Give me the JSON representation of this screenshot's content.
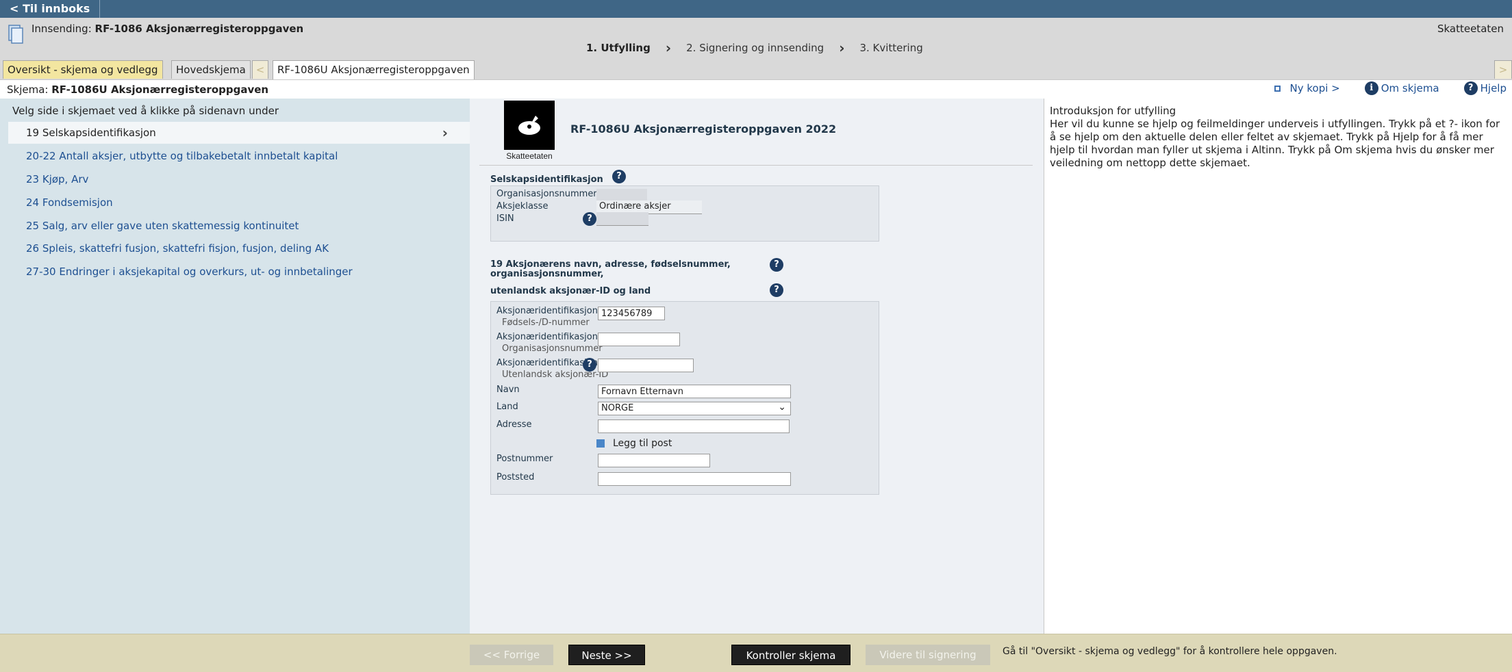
{
  "topbar": {
    "back_label": "< Til innboks"
  },
  "header": {
    "submission_prefix": "Innsending: ",
    "submission_name": "RF-1086 Aksjonærregisteroppgaven",
    "organization": "Skatteetaten",
    "steps": [
      "1. Utfylling",
      "2. Signering og innsending",
      "3. Kvittering"
    ]
  },
  "tabs": {
    "overview": "Oversikt - skjema og vedlegg",
    "main": "Hovedskjema",
    "prev_arrow": "<",
    "current": "RF-1086U Aksjonærregisteroppgaven",
    "next_arrow": ">"
  },
  "schemabar": {
    "prefix": "Skjema: ",
    "name": "RF-1086U Aksjonærregisteroppgaven",
    "new_copy": "Ny kopi >",
    "about": "Om skjema",
    "help": "Hjelp"
  },
  "sidebar": {
    "title": "Velg side i skjemaet ved å klikke på sidenavn under",
    "items": [
      {
        "label": "19 Selskapsidentifikasjon"
      },
      {
        "label": "20-22 Antall aksjer, utbytte og tilbakebetalt innbetalt kapital"
      },
      {
        "label": "23 Kjøp, Arv"
      },
      {
        "label": "24 Fondsemisjon"
      },
      {
        "label": "25 Salg, arv eller gave uten skattemessig kontinuitet"
      },
      {
        "label": "26 Spleis, skattefri fusjon, skattefri fisjon, fusjon, deling AK"
      },
      {
        "label": "27-30 Endringer i aksjekapital og overkurs, ut- og innbetalinger"
      }
    ]
  },
  "form": {
    "logo_text": "Skatteetaten",
    "title": "RF-1086U Aksjonærregisteroppgaven 2022",
    "section1": {
      "title": "Selskapsidentifikasjon",
      "org_label": "Organisasjonsnummer",
      "class_label": "Aksjeklasse",
      "class_value": "Ordinære aksjer",
      "isin_label": "ISIN"
    },
    "section2": {
      "title_line1": "19 Aksjonærens navn, adresse, fødselsnummer,",
      "title_line2": "organisasjonsnummer,",
      "title_line3": "utenlandsk aksjonær-ID og land",
      "id_label": "Aksjonæridentifikasjon",
      "id_sub1": "Fødsels-/D-nummer",
      "id_value1": "123456789",
      "id_sub2": "Organisasjonsnummer",
      "id_sub3": "Utenlandsk aksjonær-ID",
      "name_label": "Navn",
      "name_value": "Fornavn Etternavn",
      "country_label": "Land",
      "country_value": "NORGE",
      "address_label": "Adresse",
      "add_post": "Legg til post",
      "postnr_label": "Postnummer",
      "poststed_label": "Poststed"
    }
  },
  "help_panel": {
    "title": "Introduksjon for utfylling",
    "body": "Her vil du kunne se hjelp og feilmeldinger underveis i utfyllingen. Trykk på et ?- ikon for å se hjelp om den aktuelle delen eller feltet av skjemaet. Trykk på Hjelp for å få mer hjelp til hvordan man fyller ut skjema i Altinn. Trykk på Om skjema hvis du ønsker mer veiledning om nettopp dette skjemaet."
  },
  "footer": {
    "prev": "<< Forrige",
    "next": "Neste >>",
    "validate": "Kontroller skjema",
    "to_signing": "Videre til signering",
    "note": "Gå til \"Oversikt - skjema og vedlegg\" for å kontrollere hele oppgaven."
  }
}
